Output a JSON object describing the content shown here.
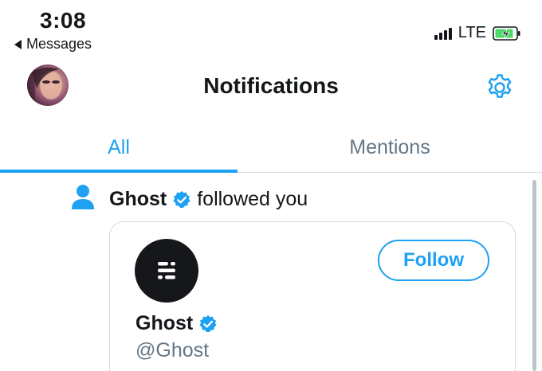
{
  "status_bar": {
    "time": "3:08",
    "back_label": "Messages",
    "network": "LTE",
    "icons": [
      "back-arrow-icon",
      "signal-icon",
      "battery-charging-icon"
    ],
    "battery_color": "#4cd964"
  },
  "header": {
    "title": "Notifications",
    "avatar_icon": "avatar",
    "settings_icon": "gear-icon"
  },
  "tabs": [
    {
      "label": "All",
      "active": true
    },
    {
      "label": "Mentions",
      "active": false
    }
  ],
  "notification": {
    "icon": "person-icon",
    "name": "Ghost",
    "verified": true,
    "action": "followed you",
    "card": {
      "name": "Ghost",
      "handle": "@Ghost",
      "follow_label": "Follow",
      "avatar_icon": "ghost-logo-icon"
    }
  },
  "colors": {
    "accent": "#1da1f2",
    "secondary_text": "#657786",
    "primary_text": "#14171a",
    "divider": "#d5dbe0"
  }
}
